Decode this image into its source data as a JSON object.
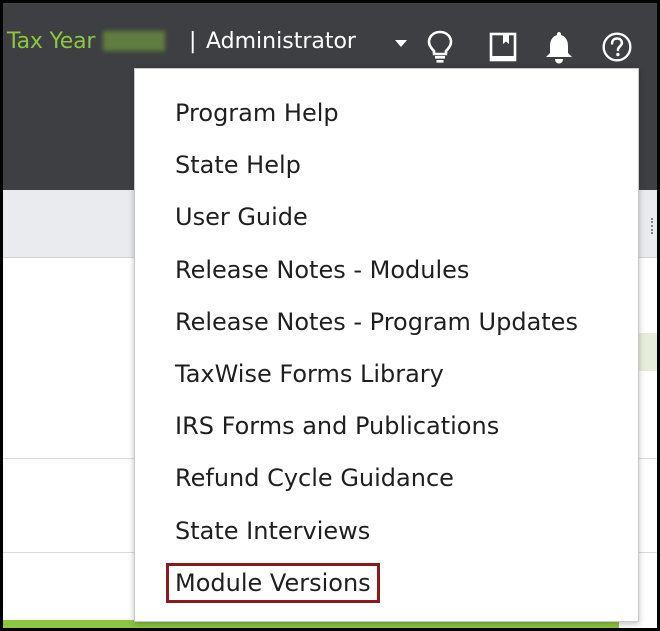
{
  "header": {
    "tax_year_label": "Tax Year",
    "separator": "|",
    "role_label": "Administrator"
  },
  "icons": {
    "bulb": "lightbulb-icon",
    "book": "book-icon",
    "bell": "bell-icon",
    "help": "help-icon"
  },
  "colors": {
    "header_bg": "#3d3f42",
    "accent_green": "#8dc63f",
    "highlight_border": "#8b1a1f"
  },
  "help_menu": {
    "items": [
      {
        "label": "Program Help"
      },
      {
        "label": "State Help"
      },
      {
        "label": "User Guide"
      },
      {
        "label": "Release Notes - Modules"
      },
      {
        "label": "Release Notes - Program Updates"
      },
      {
        "label": "TaxWise Forms Library"
      },
      {
        "label": "IRS Forms and Publications"
      },
      {
        "label": "Refund Cycle Guidance"
      },
      {
        "label": "State Interviews"
      },
      {
        "label": "Module Versions",
        "highlighted": true
      }
    ]
  }
}
